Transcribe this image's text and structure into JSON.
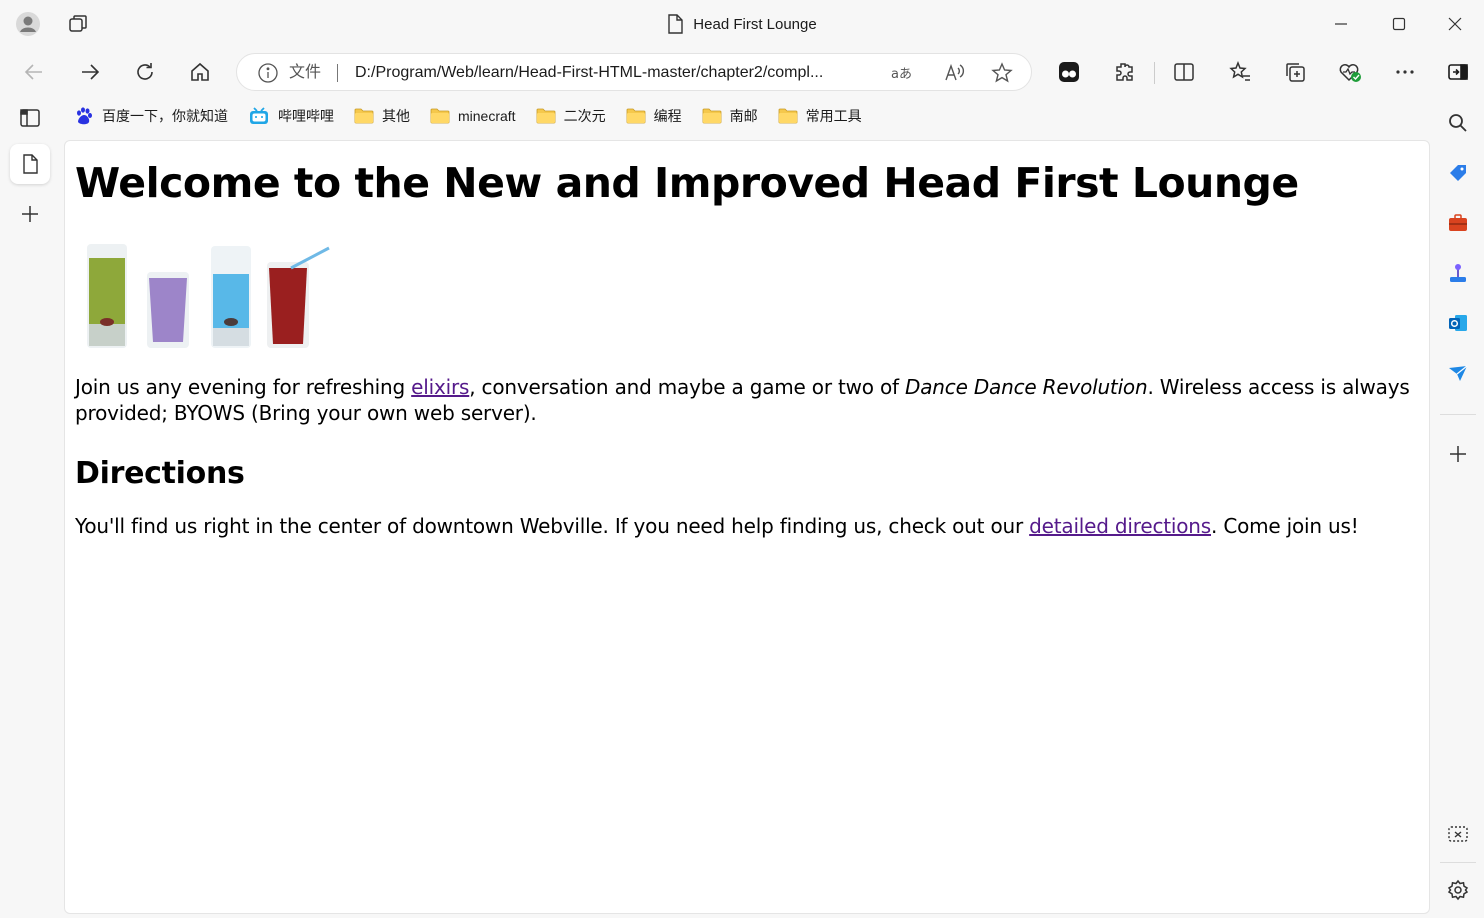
{
  "window": {
    "title": "Head First Lounge"
  },
  "toolbar": {
    "address_prefix": "文件",
    "url": "D:/Program/Web/learn/Head-First-HTML-master/chapter2/compl..."
  },
  "favorites": [
    {
      "label": "百度一下，你就知道",
      "icon": "baidu-icon"
    },
    {
      "label": "哔哩哔哩",
      "icon": "bilibili-icon"
    },
    {
      "label": "其他",
      "icon": "folder-icon"
    },
    {
      "label": "minecraft",
      "icon": "folder-icon"
    },
    {
      "label": "二次元",
      "icon": "folder-icon"
    },
    {
      "label": "编程",
      "icon": "folder-icon"
    },
    {
      "label": "南邮",
      "icon": "folder-icon"
    },
    {
      "label": "常用工具",
      "icon": "folder-icon"
    }
  ],
  "page": {
    "heading": "Welcome to the New and Improved Head First Lounge",
    "intro_before": "Join us any evening for refreshing ",
    "intro_link": "elixirs",
    "intro_middle": ", conversation and maybe a game or two of ",
    "intro_em": "Dance Dance Revolution",
    "intro_after": ". Wireless access is always provided; BYOWS (Bring your own web server).",
    "directions_heading": "Directions",
    "directions_before": "You'll find us right in the center of downtown Webville. If you need help finding us, check out our ",
    "directions_link": "detailed directions",
    "directions_after": ". Come join us!"
  },
  "colors": {
    "link_visited": "#551a8b",
    "chrome_bg": "#f7f7f7"
  }
}
